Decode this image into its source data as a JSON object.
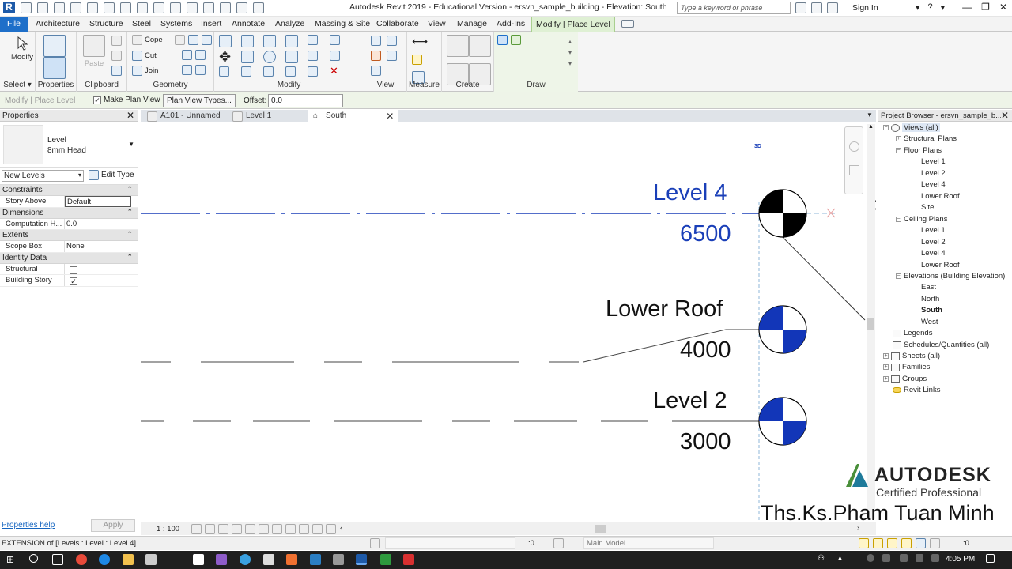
{
  "app": {
    "logo_letter": "R",
    "title": "Autodesk Revit 2019 - Educational Version - ersvn_sample_building - Elevation: South",
    "search_placeholder": "Type a keyword or phrase",
    "sign_in": "Sign In"
  },
  "ribbon_tabs": [
    {
      "label": "File"
    },
    {
      "label": "Architecture"
    },
    {
      "label": "Structure"
    },
    {
      "label": "Steel"
    },
    {
      "label": "Systems"
    },
    {
      "label": "Insert"
    },
    {
      "label": "Annotate"
    },
    {
      "label": "Analyze"
    },
    {
      "label": "Massing & Site"
    },
    {
      "label": "Collaborate"
    },
    {
      "label": "View"
    },
    {
      "label": "Manage"
    },
    {
      "label": "Add-Ins"
    },
    {
      "label": "Modify | Place Level"
    }
  ],
  "ribbon": {
    "modify": "Modify",
    "select": "Select",
    "properties": "Properties",
    "paste": "Paste",
    "clipboard": "Clipboard",
    "cope": "Cope",
    "cut": "Cut",
    "join": "Join",
    "geometry": "Geometry",
    "modify_panel": "Modify",
    "view_panel": "View",
    "measure_panel": "Measure",
    "create_panel": "Create",
    "draw_panel": "Draw"
  },
  "options_bar": {
    "context": "Modify | Place Level",
    "make_plan_view": "Make Plan View",
    "make_plan_view_checked": true,
    "plan_view_types": "Plan View Types...",
    "offset_label": "Offset:",
    "offset_value": "0.0"
  },
  "properties": {
    "title": "Properties",
    "type_family": "Level",
    "type_name": "8mm Head",
    "instance_filter": "New Levels",
    "edit_type": "Edit Type",
    "groups": {
      "constraints": "Constraints",
      "dimensions": "Dimensions",
      "extents": "Extents",
      "identity": "Identity Data"
    },
    "rows": {
      "story_above": {
        "key": "Story Above",
        "value": "Default"
      },
      "computation": {
        "key": "Computation H...",
        "value": "0.0"
      },
      "scope_box": {
        "key": "Scope Box",
        "value": "None"
      },
      "structural": {
        "key": "Structural",
        "checked": false
      },
      "building_story": {
        "key": "Building Story",
        "checked": true
      }
    },
    "help": "Properties help",
    "apply": "Apply"
  },
  "view_tabs": [
    {
      "label": "A101 - Unnamed"
    },
    {
      "label": "Level 1"
    },
    {
      "label": "South"
    }
  ],
  "canvas": {
    "badge_3d": "3D",
    "levels": [
      {
        "name": "Level 4",
        "elevation": "6500",
        "selected": true
      },
      {
        "name": "Lower Roof",
        "elevation": "4000",
        "selected": false
      },
      {
        "name": "Level 2",
        "elevation": "3000",
        "selected": false
      }
    ],
    "colors": {
      "level_selected": "#1a3fb8",
      "level_head_fill": "#1236b8",
      "level_head_selected": "#000000"
    }
  },
  "view_control": {
    "scale": "1 : 100"
  },
  "project_browser": {
    "title": "Project Browser - ersvn_sample_b...",
    "nodes": {
      "views_all": "Views (all)",
      "structural_plans": "Structural Plans",
      "floor_plans": "Floor Plans",
      "fp": [
        "Level 1",
        "Level 2",
        "Level 4",
        "Lower Roof",
        "Site"
      ],
      "ceiling_plans": "Ceiling Plans",
      "cp": [
        "Level 1",
        "Level 2",
        "Level 4",
        "Lower Roof"
      ],
      "elevations": "Elevations (Building Elevation)",
      "el": [
        "East",
        "North",
        "South",
        "West"
      ],
      "legends": "Legends",
      "schedules": "Schedules/Quantities (all)",
      "sheets": "Sheets (all)",
      "families": "Families",
      "groups": "Groups",
      "revit_links": "Revit Links"
    }
  },
  "watermark": {
    "brand": "AUTODESK",
    "cert": "Certified Professional",
    "author": "Ths.Ks.Pham Tuan Minh"
  },
  "status": {
    "text": "EXTENSION  of [Levels : Level : Level 4]",
    "zero": ":0",
    "workset": "Main Model",
    "filter": ":0"
  },
  "taskbar": {
    "clock": "4:05 PM"
  }
}
